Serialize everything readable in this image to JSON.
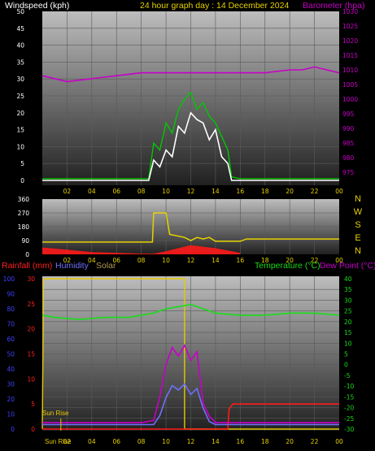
{
  "header": {
    "windspeed_label": "Windspeed (kph)",
    "title": "24 hour graph day : 14 December 2024",
    "barometer_label": "Barometer (hpa)"
  },
  "legend": {
    "rainfall": "Rainfall (mm)",
    "humidity": "Humidity",
    "solar": "Solar",
    "temperature": "Temperature (°C)",
    "dewpoint": "Dew Point (°C)",
    "sunrise": "Sun Rise"
  },
  "compass": [
    "N",
    "W",
    "S",
    "E",
    "N"
  ],
  "colors": {
    "wind": "#ffffff",
    "gust": "#00c800",
    "barometer": "#c800c8",
    "direction": "#e6d200",
    "rain": "#ff1a1a",
    "humidity": "#7070ff",
    "solar": "#e6c800",
    "temperature": "#19dd19",
    "dewpoint": "#c800c8",
    "left_axis_ticks": "#4040ff",
    "rain_axis_ticks": "#ff2020",
    "temp_axis_ticks": "#19dd19"
  },
  "chart_data": [
    {
      "type": "line",
      "title": "24 hour graph day : 14 December 2024",
      "xlabel": "",
      "x_ticks": [
        "02",
        "04",
        "06",
        "08",
        "10",
        "12",
        "14",
        "16",
        "18",
        "20",
        "22",
        "00"
      ],
      "ylim_left": [
        0,
        50
      ],
      "y_ticks_left": [
        "0",
        "5",
        "10",
        "15",
        "20",
        "25",
        "30",
        "35",
        "40",
        "45",
        "50"
      ],
      "ylim_right": [
        970,
        1030
      ],
      "y_ticks_right": [
        "975",
        "980",
        "985",
        "990",
        "995",
        "1000",
        "1005",
        "1010",
        "1015",
        "1020",
        "1025",
        "1030"
      ],
      "series": [
        {
          "name": "Windspeed (kph)",
          "axis": "left",
          "x": [
            0,
            8,
            8.6,
            9,
            9.5,
            10,
            10.5,
            11,
            11.5,
            12,
            12.5,
            13,
            13.5,
            14,
            14.5,
            15,
            15.3,
            16,
            24
          ],
          "y": [
            0,
            0,
            0,
            6,
            4,
            9,
            7,
            16,
            14,
            20,
            18,
            17,
            12,
            15,
            7,
            5,
            0,
            0,
            0
          ]
        },
        {
          "name": "Gust",
          "axis": "left",
          "x": [
            0,
            8,
            8.6,
            9,
            9.5,
            10,
            10.5,
            11,
            11.5,
            12,
            12.5,
            13,
            13.5,
            14,
            14.5,
            15,
            15.3,
            16,
            24
          ],
          "y": [
            0.5,
            0.5,
            0.5,
            11,
            9,
            17,
            14,
            21,
            24,
            26,
            21,
            23,
            19,
            17,
            13,
            9,
            1,
            0.5,
            0.5
          ]
        },
        {
          "name": "Barometer (hpa)",
          "axis": "right",
          "x": [
            0,
            2,
            4,
            6,
            8,
            10,
            12,
            14,
            16,
            18,
            20,
            21,
            22,
            23,
            24
          ],
          "y": [
            1008,
            1006,
            1007,
            1008,
            1009,
            1009,
            1009,
            1009,
            1009,
            1009,
            1010,
            1010,
            1011,
            1010,
            1009
          ]
        }
      ]
    },
    {
      "type": "line",
      "title": "",
      "x_ticks": [
        "02",
        "04",
        "06",
        "08",
        "10",
        "12",
        "14",
        "16",
        "18",
        "20",
        "22",
        "00"
      ],
      "ylim": [
        0,
        360
      ],
      "y_ticks": [
        "0",
        "90",
        "180",
        "270",
        "360"
      ],
      "series": [
        {
          "name": "Wind Direction",
          "x": [
            0,
            8.9,
            9,
            10,
            10.3,
            11.5,
            12,
            12.5,
            13,
            13.5,
            14,
            16,
            16.5,
            24
          ],
          "y": [
            80,
            80,
            270,
            270,
            130,
            110,
            90,
            110,
            100,
            110,
            85,
            85,
            100,
            100
          ]
        },
        {
          "name": "Gust Direction",
          "x": [
            0,
            2,
            4,
            6,
            8,
            9,
            10,
            11,
            12,
            13,
            14,
            15,
            16
          ],
          "y": [
            45,
            30,
            15,
            10,
            5,
            5,
            20,
            40,
            60,
            50,
            40,
            25,
            10
          ]
        }
      ]
    },
    {
      "type": "line",
      "title": "",
      "x_ticks": [
        "02",
        "04",
        "06",
        "08",
        "10",
        "12",
        "14",
        "16",
        "18",
        "20",
        "22",
        "00"
      ],
      "ylim_left": [
        0,
        100
      ],
      "y_ticks_humidity": [
        "0",
        "10",
        "20",
        "30",
        "40",
        "50",
        "60",
        "70",
        "80",
        "90",
        "100"
      ],
      "ylim_rain": [
        0,
        30
      ],
      "y_ticks_rain": [
        "0",
        "5",
        "10",
        "15",
        "20",
        "25",
        "30"
      ],
      "ylim_right": [
        -30,
        40
      ],
      "y_ticks_right": [
        "-30",
        "-25",
        "-20",
        "-15",
        "-10",
        "-5",
        "0",
        "5",
        "10",
        "15",
        "20",
        "25",
        "30",
        "35",
        "40"
      ],
      "series": [
        {
          "name": "Rainfall (mm)",
          "axis": "rain",
          "x": [
            0,
            15,
            15.1,
            15.4,
            24
          ],
          "y": [
            0,
            0,
            4,
            5,
            5
          ]
        },
        {
          "name": "Humidity",
          "axis": "left",
          "x": [
            0,
            9,
            9.5,
            10,
            10.5,
            11,
            11.5,
            12,
            12.5,
            13,
            13.5,
            14,
            24
          ],
          "y": [
            3,
            3,
            9,
            21,
            29,
            26,
            30,
            23,
            27,
            14,
            5,
            3,
            3
          ]
        },
        {
          "name": "Solar",
          "axis": "left",
          "x": [
            0,
            0.1,
            0.1,
            11.5,
            11.5,
            24
          ],
          "y": [
            0,
            100,
            100,
            100,
            0,
            0
          ]
        },
        {
          "name": "Temperature (°C)",
          "axis": "right",
          "x": [
            0,
            1,
            3,
            5,
            7,
            8,
            9,
            10,
            11,
            12,
            13,
            14,
            16,
            18,
            20,
            22,
            24
          ],
          "y": [
            23,
            22,
            21,
            22,
            22,
            23,
            24,
            26,
            27,
            28,
            26,
            24,
            23,
            23,
            24,
            24,
            23
          ]
        },
        {
          "name": "Dew Point (°C)",
          "axis": "right",
          "x": [
            0,
            5,
            8,
            9,
            9.5,
            10,
            10.5,
            11,
            11.5,
            12,
            12.5,
            13,
            13.5,
            14,
            16,
            20,
            24
          ],
          "y": [
            -27,
            -27,
            -27,
            -26,
            -15,
            0,
            8,
            4,
            9,
            2,
            6,
            -18,
            -24,
            -27,
            -27,
            -27,
            -27
          ]
        }
      ],
      "sunrise_hour": 1.5
    }
  ]
}
